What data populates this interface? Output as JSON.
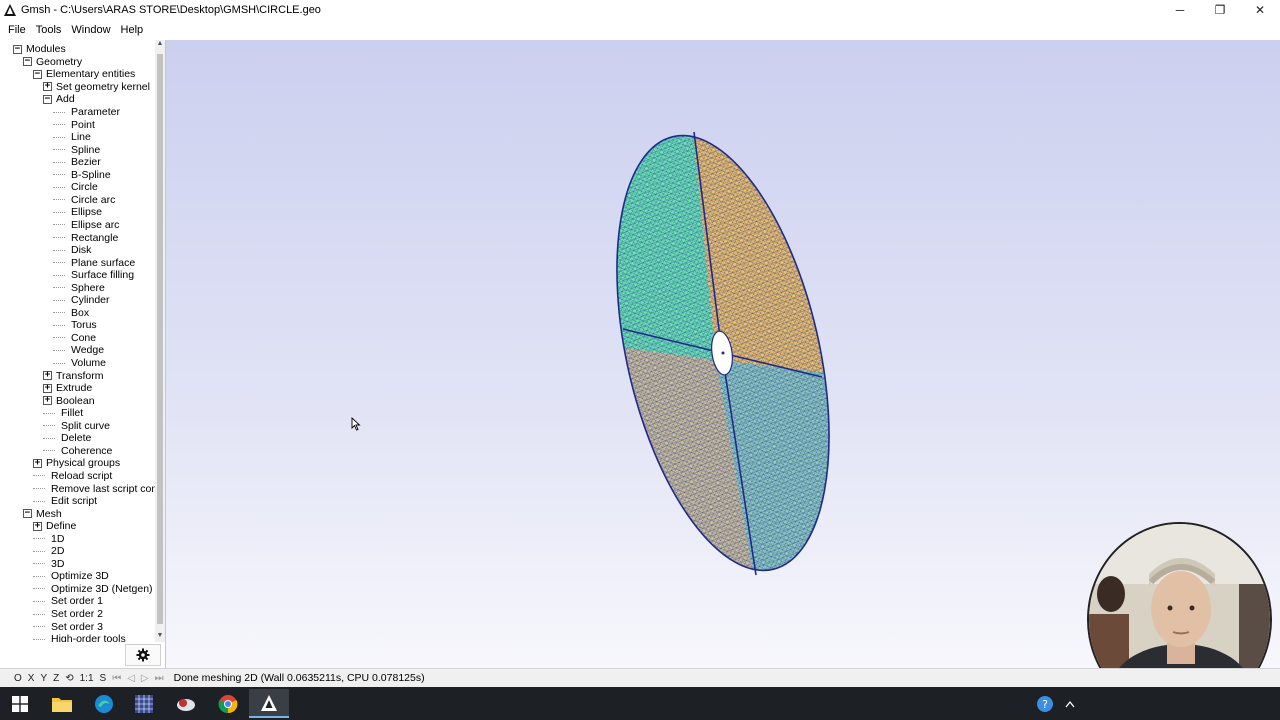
{
  "window": {
    "title": "Gmsh - C:\\Users\\ARAS STORE\\Desktop\\GMSH\\CIRCLE.geo",
    "controls": [
      "─",
      "❐",
      "✕"
    ]
  },
  "menu": [
    "File",
    "Tools",
    "Window",
    "Help"
  ],
  "tree": [
    {
      "label": "Modules",
      "level": 0,
      "box": "-"
    },
    {
      "label": "Geometry",
      "level": 1,
      "box": "-"
    },
    {
      "label": "Elementary entities",
      "level": 2,
      "box": "-"
    },
    {
      "label": "Set geometry kernel",
      "level": 3,
      "box": "+"
    },
    {
      "label": "Add",
      "level": 3,
      "box": "-"
    },
    {
      "label": "Parameter",
      "level": 4
    },
    {
      "label": "Point",
      "level": 4
    },
    {
      "label": "Line",
      "level": 4
    },
    {
      "label": "Spline",
      "level": 4
    },
    {
      "label": "Bezier",
      "level": 4
    },
    {
      "label": "B-Spline",
      "level": 4
    },
    {
      "label": "Circle",
      "level": 4
    },
    {
      "label": "Circle arc",
      "level": 4
    },
    {
      "label": "Ellipse",
      "level": 4
    },
    {
      "label": "Ellipse arc",
      "level": 4
    },
    {
      "label": "Rectangle",
      "level": 4
    },
    {
      "label": "Disk",
      "level": 4
    },
    {
      "label": "Plane surface",
      "level": 4
    },
    {
      "label": "Surface filling",
      "level": 4
    },
    {
      "label": "Sphere",
      "level": 4
    },
    {
      "label": "Cylinder",
      "level": 4
    },
    {
      "label": "Box",
      "level": 4
    },
    {
      "label": "Torus",
      "level": 4
    },
    {
      "label": "Cone",
      "level": 4
    },
    {
      "label": "Wedge",
      "level": 4
    },
    {
      "label": "Volume",
      "level": 4
    },
    {
      "label": "Transform",
      "level": 3,
      "box": "+"
    },
    {
      "label": "Extrude",
      "level": 3,
      "box": "+"
    },
    {
      "label": "Boolean",
      "level": 3,
      "box": "+"
    },
    {
      "label": "Fillet",
      "level": 3
    },
    {
      "label": "Split curve",
      "level": 3
    },
    {
      "label": "Delete",
      "level": 3
    },
    {
      "label": "Coherence",
      "level": 3
    },
    {
      "label": "Physical groups",
      "level": 2,
      "box": "+"
    },
    {
      "label": "Reload script",
      "level": 2
    },
    {
      "label": "Remove last script command",
      "level": 2
    },
    {
      "label": "Edit script",
      "level": 2
    },
    {
      "label": "Mesh",
      "level": 1,
      "box": "-"
    },
    {
      "label": "Define",
      "level": 2,
      "box": "+"
    },
    {
      "label": "1D",
      "level": 2
    },
    {
      "label": "2D",
      "level": 2
    },
    {
      "label": "3D",
      "level": 2
    },
    {
      "label": "Optimize 3D",
      "level": 2
    },
    {
      "label": "Optimize 3D (Netgen)",
      "level": 2
    },
    {
      "label": "Set order 1",
      "level": 2
    },
    {
      "label": "Set order 2",
      "level": 2
    },
    {
      "label": "Set order 3",
      "level": 2
    },
    {
      "label": "High-order tools",
      "level": 2
    }
  ],
  "status": {
    "buttons": [
      "O",
      "X",
      "Y",
      "Z",
      "⟲",
      "1:1",
      "S",
      "⏮",
      "◁",
      "▷",
      "⏭"
    ],
    "message": "Done meshing 2D (Wall 0.0635211s, CPU 0.078125s)"
  },
  "taskbar": {
    "items": [
      "windows-start",
      "file-explorer",
      "edge",
      "app-grid",
      "app-cloud",
      "chrome",
      "gmsh"
    ]
  },
  "colors": {
    "viewport_top": "#ccd0ef",
    "viewport_bottom": "#f7f7fc",
    "surface_green": "#6ee8b4",
    "surface_orange": "#f2c66a",
    "surface_olive": "#cfc49a",
    "surface_teal": "#8fcfc0",
    "mesh_line": "#1e2a8c",
    "taskbar": "#1d2126"
  }
}
